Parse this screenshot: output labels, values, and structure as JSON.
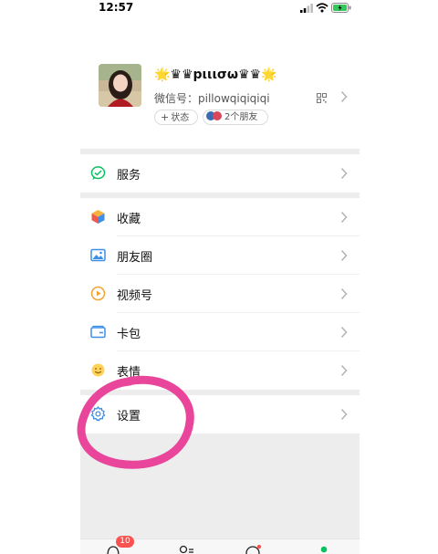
{
  "status_bar": {
    "time": "12:57"
  },
  "profile": {
    "nickname": "🌟♛♛pιιισω♛♛🌟",
    "wechat_id": "微信号：pillowqiqiqiqi",
    "status_chip": "状态",
    "friends_chip": "2个朋友"
  },
  "menu": {
    "services": "服务",
    "favorites": "收藏",
    "moments": "朋友圈",
    "channels": "视频号",
    "cards": "卡包",
    "stickers": "表情",
    "settings": "设置"
  },
  "tabbar": {
    "badge": "10"
  },
  "colors": {
    "accent_green": "#07c160",
    "highlight_pink": "#e8459b",
    "badge_red": "#fa5151"
  }
}
